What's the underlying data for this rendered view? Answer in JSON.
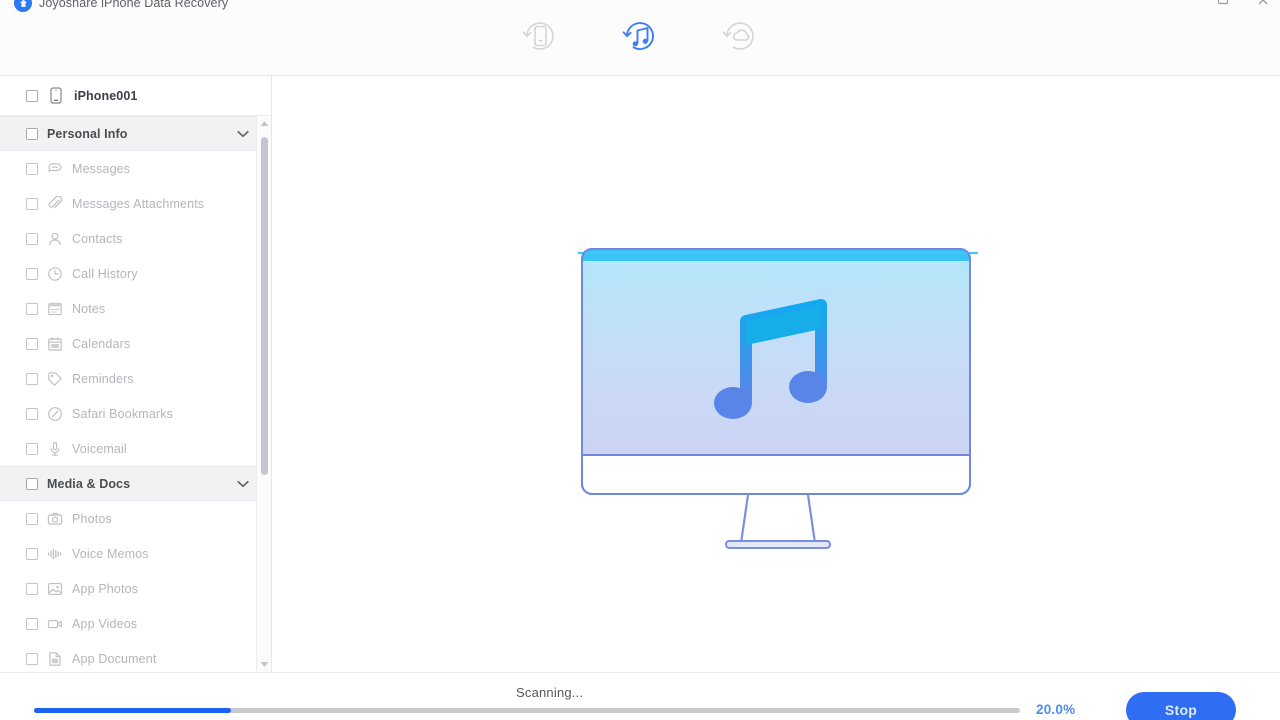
{
  "window": {
    "title": "Joyoshare iPhone Data Recovery",
    "logo_icon": "app-logo-icon",
    "controls": [
      {
        "name": "minimize-button",
        "icon": "minimize-icon"
      },
      {
        "name": "close-button",
        "icon": "close-icon"
      }
    ]
  },
  "toolbar": {
    "modes": [
      {
        "id": "device",
        "icon": "recover-from-idevice-icon",
        "active": false
      },
      {
        "id": "itunes",
        "icon": "recover-from-itunes-icon",
        "active": true
      },
      {
        "id": "icloud",
        "icon": "recover-from-icloud-icon",
        "active": false
      }
    ],
    "accent": "#3f7df5"
  },
  "sidebar": {
    "device": {
      "label": "iPhone001",
      "icon": "iphone-icon",
      "checked": false
    },
    "groups": [
      {
        "label": "Personal Info",
        "expanded": true,
        "chevron": "chevron-down-icon",
        "items": [
          {
            "label": "Messages",
            "icon": "message-bubble-icon"
          },
          {
            "label": "Messages Attachments",
            "icon": "paperclip-icon"
          },
          {
            "label": "Contacts",
            "icon": "person-icon"
          },
          {
            "label": "Call History",
            "icon": "clock-icon"
          },
          {
            "label": "Notes",
            "icon": "notes-icon"
          },
          {
            "label": "Calendars",
            "icon": "calendar-icon"
          },
          {
            "label": "Reminders",
            "icon": "reminder-tag-icon"
          },
          {
            "label": "Safari Bookmarks",
            "icon": "safari-compass-icon"
          },
          {
            "label": "Voicemail",
            "icon": "microphone-icon"
          }
        ]
      },
      {
        "label": "Media & Docs",
        "expanded": true,
        "chevron": "chevron-down-icon",
        "items": [
          {
            "label": "Photos",
            "icon": "camera-icon"
          },
          {
            "label": "Voice Memos",
            "icon": "waveform-icon"
          },
          {
            "label": "App Photos",
            "icon": "image-icon"
          },
          {
            "label": "App Videos",
            "icon": "video-camera-icon"
          },
          {
            "label": "App Document",
            "icon": "document-icon"
          }
        ]
      }
    ],
    "scrollbar": {
      "up_arrow": "scroll-up-icon",
      "down_arrow": "scroll-down-icon"
    }
  },
  "stage": {
    "illustration": "imac-music-note-illustration"
  },
  "footer": {
    "status": "Scanning...",
    "percent_label": "20.0%",
    "percent_value": 20,
    "stop_label": "Stop",
    "progress_color": "#1a62ef",
    "stop_color": "#2f6ef2"
  }
}
